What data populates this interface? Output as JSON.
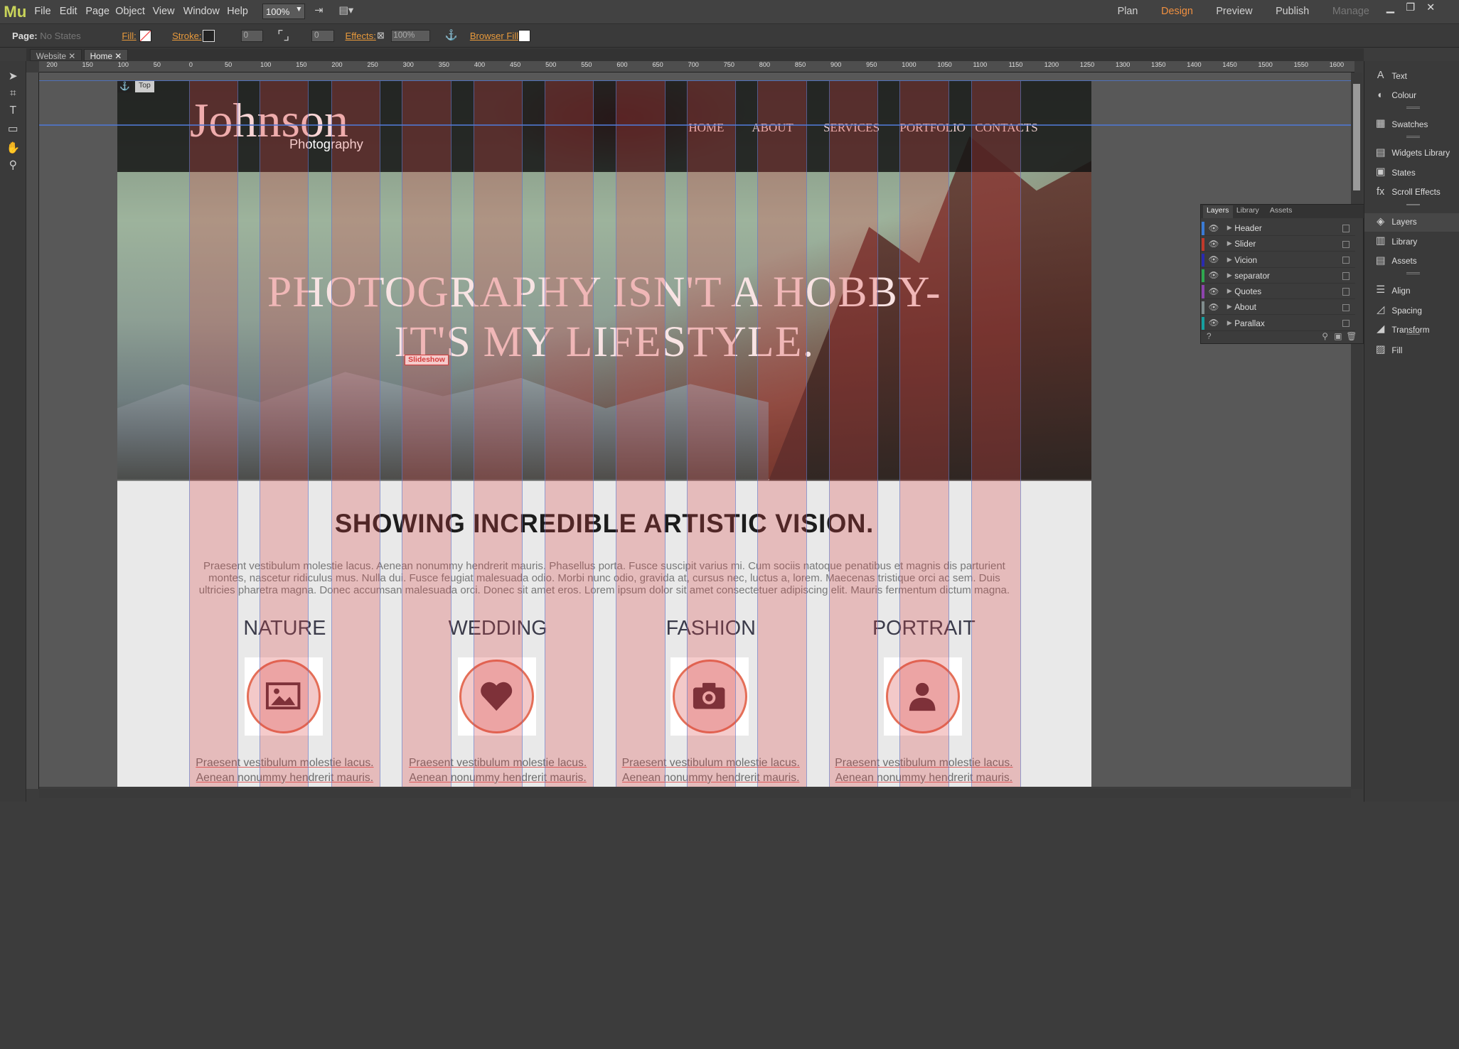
{
  "app": {
    "logo": "Mu"
  },
  "menus": [
    "File",
    "Edit",
    "Page",
    "Object",
    "View",
    "Window",
    "Help"
  ],
  "zoom": "100%",
  "modes": {
    "plan": "Plan",
    "design": "Design",
    "preview": "Preview",
    "publish": "Publish",
    "manage": "Manage"
  },
  "control": {
    "page_label": "Page:",
    "page_state": "No States",
    "fill_label": "Fill:",
    "stroke_label": "Stroke:",
    "stroke_value": "0",
    "corner_value": "0",
    "effects_label": "Effects:",
    "effects_value": "100%",
    "browser_fill_label": "Browser Fill:"
  },
  "doc_tabs": [
    {
      "label": "Website"
    },
    {
      "label": "Home"
    }
  ],
  "ruler_labels": [
    "200",
    "150",
    "100",
    "50",
    "0",
    "50",
    "100",
    "150",
    "200",
    "250",
    "300",
    "350",
    "400",
    "450",
    "500",
    "550",
    "600",
    "650",
    "700",
    "750",
    "800",
    "850",
    "900",
    "950",
    "1000",
    "1050",
    "1100",
    "1150",
    "1200",
    "1250",
    "1300",
    "1350",
    "1400",
    "1450",
    "1500",
    "1550",
    "1600"
  ],
  "site": {
    "anchor_label": "Top",
    "brand_name": "Johnson",
    "brand_sub": "Photography",
    "nav": [
      "HOME",
      "ABOUT",
      "SERVICES",
      "PORTFOLIO",
      "CONTACTS"
    ],
    "hero_line1": "PHOTOGRAPHY ISN'T A HOBBY-",
    "hero_line2": "IT'S MY LIFESTYLE.",
    "slideshow_label": "Slideshow",
    "section_title": "SHOWING INCREDIBLE ARTISTIC VISION.",
    "section_text": "Praesent vestibulum molestie lacus. Aenean nonummy hendrerit mauris. Phasellus porta. Fusce suscipit varius mi. Cum sociis natoque penatibus et magnis dis parturient montes, nascetur ridiculus mus. Nulla dui. Fusce feugiat malesuada odio. Morbi nunc odio, gravida at, cursus nec, luctus a, lorem. Maecenas tristique orci ac sem. Duis ultricies pharetra magna. Donec accumsan malesuada orci. Donec sit amet eros. Lorem ipsum dolor sit amet consectetuer adipiscing elit. Mauris fermentum dictum magna.",
    "categories": [
      {
        "title": "NATURE",
        "icon": "image-icon",
        "text1": "Praesent vestibulum molestie lacus.",
        "text2": "Aenean nonummy hendrerit mauris."
      },
      {
        "title": "WEDDING",
        "icon": "heart-icon",
        "text1": "Praesent vestibulum molestie lacus.",
        "text2": "Aenean nonummy hendrerit mauris."
      },
      {
        "title": "FASHION",
        "icon": "camera-icon",
        "text1": "Praesent vestibulum molestie lacus.",
        "text2": "Aenean nonummy hendrerit mauris."
      },
      {
        "title": "PORTRAIT",
        "icon": "person-icon",
        "text1": "Praesent vestibulum molestie lacus.",
        "text2": "Aenean nonummy hendrerit mauris."
      }
    ]
  },
  "layers_panel": {
    "tabs": [
      "Layers",
      "Library",
      "Assets"
    ],
    "layers": [
      {
        "name": "Header",
        "color": "#3a7bd5"
      },
      {
        "name": "Slider",
        "color": "#c0392b"
      },
      {
        "name": "Vicion",
        "color": "#2a2ab0"
      },
      {
        "name": "separator",
        "color": "#2fa84f"
      },
      {
        "name": "Quotes",
        "color": "#8e44ad"
      },
      {
        "name": "About",
        "color": "#7f8c8d"
      },
      {
        "name": "Parallax",
        "color": "#16a0a0"
      }
    ]
  },
  "right_panel": [
    {
      "label": "Text",
      "icon": "text-icon"
    },
    {
      "label": "Colour",
      "icon": "colour-icon"
    },
    {
      "label": "Swatches",
      "icon": "swatches-icon"
    },
    {
      "label": "Widgets Library",
      "icon": "widgets-icon"
    },
    {
      "label": "States",
      "icon": "states-icon"
    },
    {
      "label": "Scroll Effects",
      "icon": "fx-icon"
    },
    {
      "label": "Layers",
      "icon": "layers-icon"
    },
    {
      "label": "Library",
      "icon": "library-icon"
    },
    {
      "label": "Assets",
      "icon": "assets-icon"
    },
    {
      "label": "Align",
      "icon": "align-icon"
    },
    {
      "label": "Spacing",
      "icon": "spacing-icon"
    },
    {
      "label": "Transform",
      "icon": "transform-icon"
    },
    {
      "label": "Fill",
      "icon": "fill-icon"
    }
  ],
  "colors": {
    "accent": "#f09040",
    "grid_column": "#dc4646",
    "icon_ring": "#e46e57"
  }
}
